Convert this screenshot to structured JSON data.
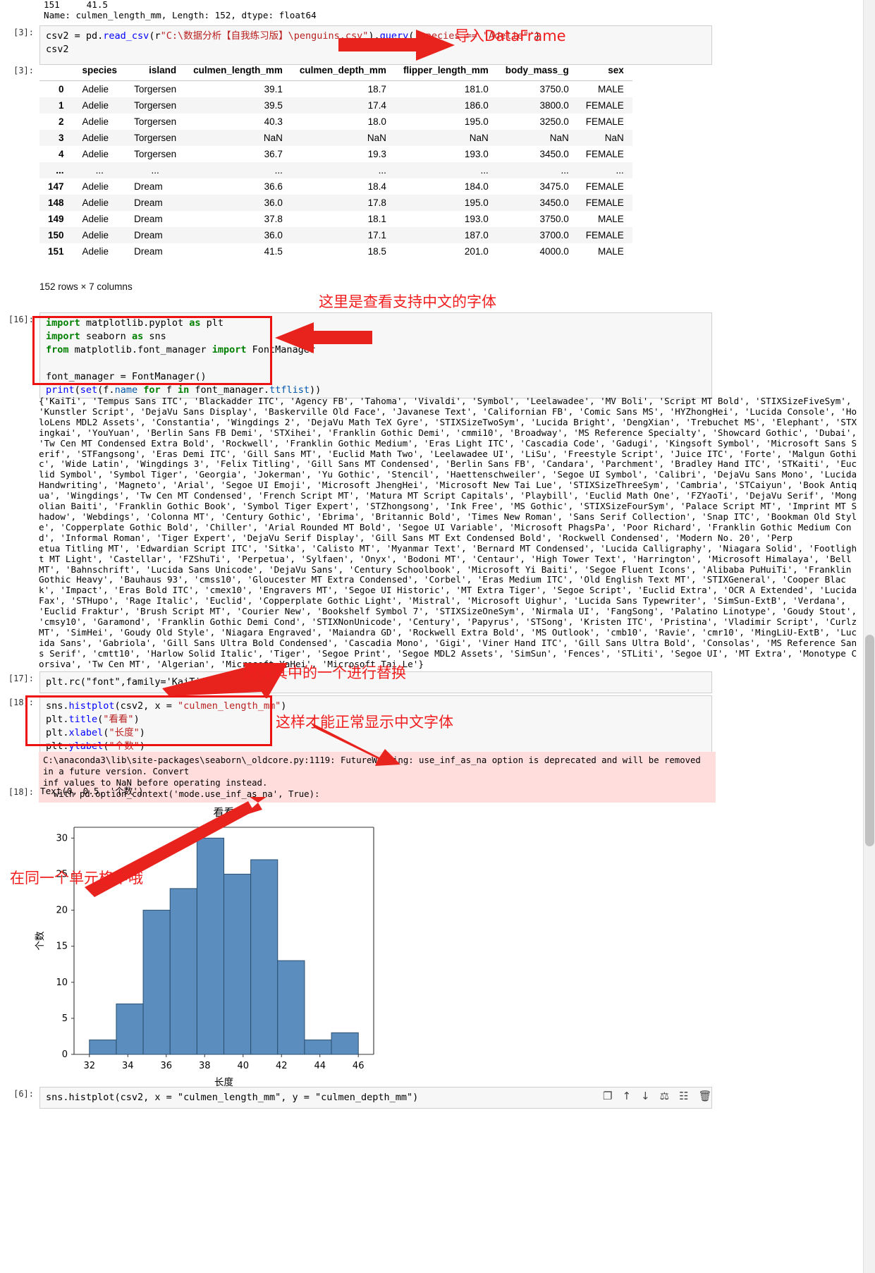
{
  "top_output": "151     41.5\nName: culmen_length_mm, Length: 152, dtype: float64",
  "cells": {
    "c3": {
      "prompt": "[3]:",
      "code_line1_a": "csv2 = pd.",
      "code_line1_fn": "read_csv",
      "code_line1_b": "(r",
      "code_line1_str": "\"C:\\数据分析【自我练习版】\\penguins.csv\"",
      "code_line1_c": ").",
      "code_line1_fn2": "query",
      "code_line1_d": "(",
      "code_line1_str2": "'species == \"Adelie\"'",
      "code_line1_e": ")",
      "code_line2": "csv2"
    },
    "c3out_prompt": "[3]:",
    "c16": {
      "prompt": "[16]:",
      "lines": [
        "import matplotlib.pyplot as plt",
        "import seaborn as sns",
        "from matplotlib.font_manager import FontManager",
        "",
        "font_manager = FontManager()",
        "print(set(f.name for f in font_manager.ttflist))"
      ]
    },
    "c17": {
      "prompt": "[17]:",
      "code": "plt.rc(\"font\",family='KaiTi')"
    },
    "c18": {
      "prompt": "[18]:",
      "lines": [
        "sns.histplot(csv2, x = \"culmen_length_mm\")",
        "plt.title(\"看看\")",
        "plt.xlabel(\"长度\")",
        "plt.ylabel(\"个数\")"
      ]
    },
    "c18out_prompt": "[18]:",
    "c18out_text": "Text(0, 0.5, '个数')",
    "c6": {
      "prompt": "[6]:",
      "code": "sns.histplot(csv2, x = \"culmen_length_mm\", y = \"culmen_depth_mm\")"
    }
  },
  "dataframe": {
    "columns": [
      "species",
      "island",
      "culmen_length_mm",
      "culmen_depth_mm",
      "flipper_length_mm",
      "body_mass_g",
      "sex"
    ],
    "rows": [
      {
        "idx": "0",
        "species": "Adelie",
        "island": "Torgersen",
        "culmen_length_mm": "39.1",
        "culmen_depth_mm": "18.7",
        "flipper_length_mm": "181.0",
        "body_mass_g": "3750.0",
        "sex": "MALE"
      },
      {
        "idx": "1",
        "species": "Adelie",
        "island": "Torgersen",
        "culmen_length_mm": "39.5",
        "culmen_depth_mm": "17.4",
        "flipper_length_mm": "186.0",
        "body_mass_g": "3800.0",
        "sex": "FEMALE"
      },
      {
        "idx": "2",
        "species": "Adelie",
        "island": "Torgersen",
        "culmen_length_mm": "40.3",
        "culmen_depth_mm": "18.0",
        "flipper_length_mm": "195.0",
        "body_mass_g": "3250.0",
        "sex": "FEMALE"
      },
      {
        "idx": "3",
        "species": "Adelie",
        "island": "Torgersen",
        "culmen_length_mm": "NaN",
        "culmen_depth_mm": "NaN",
        "flipper_length_mm": "NaN",
        "body_mass_g": "NaN",
        "sex": "NaN"
      },
      {
        "idx": "4",
        "species": "Adelie",
        "island": "Torgersen",
        "culmen_length_mm": "36.7",
        "culmen_depth_mm": "19.3",
        "flipper_length_mm": "193.0",
        "body_mass_g": "3450.0",
        "sex": "FEMALE"
      },
      {
        "idx": "...",
        "species": "...",
        "island": "...",
        "culmen_length_mm": "...",
        "culmen_depth_mm": "...",
        "flipper_length_mm": "...",
        "body_mass_g": "...",
        "sex": "..."
      },
      {
        "idx": "147",
        "species": "Adelie",
        "island": "Dream",
        "culmen_length_mm": "36.6",
        "culmen_depth_mm": "18.4",
        "flipper_length_mm": "184.0",
        "body_mass_g": "3475.0",
        "sex": "FEMALE"
      },
      {
        "idx": "148",
        "species": "Adelie",
        "island": "Dream",
        "culmen_length_mm": "36.0",
        "culmen_depth_mm": "17.8",
        "flipper_length_mm": "195.0",
        "body_mass_g": "3450.0",
        "sex": "FEMALE"
      },
      {
        "idx": "149",
        "species": "Adelie",
        "island": "Dream",
        "culmen_length_mm": "37.8",
        "culmen_depth_mm": "18.1",
        "flipper_length_mm": "193.0",
        "body_mass_g": "3750.0",
        "sex": "MALE"
      },
      {
        "idx": "150",
        "species": "Adelie",
        "island": "Dream",
        "culmen_length_mm": "36.0",
        "culmen_depth_mm": "17.1",
        "flipper_length_mm": "187.0",
        "body_mass_g": "3700.0",
        "sex": "FEMALE"
      },
      {
        "idx": "151",
        "species": "Adelie",
        "island": "Dream",
        "culmen_length_mm": "41.5",
        "culmen_depth_mm": "18.5",
        "flipper_length_mm": "201.0",
        "body_mass_g": "4000.0",
        "sex": "MALE"
      }
    ],
    "shape": "152 rows × 7 columns"
  },
  "font_list_output": "{'KaiTi', 'Tempus Sans ITC', 'Blackadder ITC', 'Agency FB', 'Tahoma', 'Vivaldi', 'Symbol', 'Leelawadee', 'MV Boli', 'Script MT Bold', 'STIXSizeFiveSym',\n'Kunstler Script', 'DejaVu Sans Display', 'Baskerville Old Face', 'Javanese Text', 'Californian FB', 'Comic Sans MS', 'HYZhongHei', 'Lucida Console', 'Ho\nloLens MDL2 Assets', 'Constantia', 'Wingdings 2', 'DejaVu Math TeX Gyre', 'STIXSizeTwoSym', 'Lucida Bright', 'DengXian', 'Trebuchet MS', 'Elephant', 'STX\ningkai', 'YouYuan', 'Berlin Sans FB Demi', 'STXihei', 'Franklin Gothic Demi', 'cmmi10', 'Broadway', 'MS Reference Specialty', 'Showcard Gothic', 'Dubai',\n'Tw Cen MT Condensed Extra Bold', 'Rockwell', 'Franklin Gothic Medium', 'Eras Light ITC', 'Cascadia Code', 'Gadugi', 'Kingsoft Symbol', 'Microsoft Sans S\nerif', 'STFangsong', 'Eras Demi ITC', 'Gill Sans MT', 'Euclid Math Two', 'Leelawadee UI', 'LiSu', 'Freestyle Script', 'Juice ITC', 'Forte', 'Malgun Gothi\nc', 'Wide Latin', 'Wingdings 3', 'Felix Titling', 'Gill Sans MT Condensed', 'Berlin Sans FB', 'Candara', 'Parchment', 'Bradley Hand ITC', 'STKaiti', 'Euc\nlid Symbol', 'Symbol Tiger', 'Georgia', 'Jokerman', 'Yu Gothic', 'Stencil', 'Haettenschweiler', 'Segoe UI Symbol', 'Calibri', 'DejaVu Sans Mono', 'Lucida\nHandwriting', 'Magneto', 'Arial', 'Segoe UI Emoji', 'Microsoft JhengHei', 'Microsoft New Tai Lue', 'STIXSizeThreeSym', 'Cambria', 'STCaiyun', 'Book Antiq\nua', 'Wingdings', 'Tw Cen MT Condensed', 'French Script MT', 'Matura MT Script Capitals', 'Playbill', 'Euclid Math One', 'FZYaoTi', 'DejaVu Serif', 'Mong\nolian Baiti', 'Franklin Gothic Book', 'Symbol Tiger Expert', 'STZhongsong', 'Ink Free', 'MS Gothic', 'STIXSizeFourSym', 'Palace Script MT', 'Imprint MT S\nhadow', 'Webdings', 'Colonna MT', 'Century Gothic', 'Ebrima', 'Britannic Bold', 'Times New Roman', 'Sans Serif Collection', 'Snap ITC', 'Bookman Old Styl\ne', 'Copperplate Gothic Bold', 'Chiller', 'Arial Rounded MT Bold', 'Segoe UI Variable', 'Microsoft PhagsPa', 'Poor Richard', 'Franklin Gothic Medium Con\nd', 'Informal Roman', 'Tiger Expert', 'DejaVu Serif Display', 'Gill Sans MT Ext Condensed Bold', 'Rockwell Condensed', 'Modern No. 20', 'Perp\netua Titling MT', 'Edwardian Script ITC', 'Sitka', 'Calisto MT', 'Myanmar Text', 'Bernard MT Condensed', 'Lucida Calligraphy', 'Niagara Solid', 'Footligh\nt MT Light', 'Castellar', 'FZShuTi', 'Perpetua', 'Sylfaen', 'Onyx', 'Bodoni MT', 'Centaur', 'High Tower Text', 'Harrington', 'Microsoft Himalaya', 'Bell\nMT', 'Bahnschrift', 'Lucida Sans Unicode', 'DejaVu Sans', 'Century Schoolbook', 'Microsoft Yi Baiti', 'Segoe Fluent Icons', 'Alibaba PuHuiTi', 'Franklin\nGothic Heavy', 'Bauhaus 93', 'cmss10', 'Gloucester MT Extra Condensed', 'Corbel', 'Eras Medium ITC', 'Old English Text MT', 'STIXGeneral', 'Cooper Blac\nk', 'Impact', 'Eras Bold ITC', 'cmex10', 'Engravers MT', 'Segoe UI Historic', 'MT Extra Tiger', 'Segoe Script', 'Euclid Extra', 'OCR A Extended', 'Lucida\nFax', 'STHupo', 'Rage Italic', 'Euclid', 'Copperplate Gothic Light', 'Mistral', 'Microsoft Uighur', 'Lucida Sans Typewriter', 'SimSun-ExtB', 'Verdana',\n'Euclid Fraktur', 'Brush Script MT', 'Courier New', 'Bookshelf Symbol 7', 'STIXSizeOneSym', 'Nirmala UI', 'FangSong', 'Palatino Linotype', 'Goudy Stout',\n'cmsy10', 'Garamond', 'Franklin Gothic Demi Cond', 'STIXNonUnicode', 'Century', 'Papyrus', 'STSong', 'Kristen ITC', 'Pristina', 'Vladimir Script', 'Curlz\nMT', 'SimHei', 'Goudy Old Style', 'Niagara Engraved', 'Maiandra GD', 'Rockwell Extra Bold', 'MS Outlook', 'cmb10', 'Ravie', 'cmr10', 'MingLiU-ExtB', 'Luc\nida Sans', 'Gabriola', 'Gill Sans Ultra Bold Condensed', 'Cascadia Mono', 'Gigi', 'Viner Hand ITC', 'Gill Sans Ultra Bold', 'Consolas', 'MS Reference San\ns Serif', 'cmtt10', 'Harlow Solid Italic', 'Tiger', 'Segoe Print', 'Segoe MDL2 Assets', 'SimSun', 'Fences', 'STLiti', 'Segoe UI', 'MT Extra', 'Monotype C\norsiva', 'Tw Cen MT', 'Algerian', 'Microsoft YaHei', 'Microsoft Tai Le'}",
  "warning_output": "C:\\anaconda3\\lib\\site-packages\\seaborn\\_oldcore.py:1119: FutureWarning: use_inf_as_na option is deprecated and will be removed in a future version. Convert\ninf values to NaN before operating instead.\n  with pd.option_context('mode.use_inf_as_na', True):",
  "annotations": [
    {
      "id": "a1",
      "text": "导入DataFrame"
    },
    {
      "id": "a2",
      "text": "这里是查看支持中文的字体"
    },
    {
      "id": "a3",
      "text": "选择其中的一个进行替换"
    },
    {
      "id": "a4",
      "text": "这样才能正常显示中文字体"
    },
    {
      "id": "a5",
      "text": "在同一个单元格中哦"
    }
  ],
  "toolbar_icons": [
    "copy-icon",
    "move-up-icon",
    "move-down-icon",
    "merge-icon",
    "split-icon",
    "delete-icon"
  ],
  "chart_data": {
    "type": "bar",
    "title": "看看",
    "xlabel": "长度",
    "ylabel": "个数",
    "bin_edges": [
      32.0,
      33.4,
      34.8,
      36.2,
      37.6,
      39.0,
      40.4,
      41.8,
      43.2,
      44.6,
      46.0
    ],
    "categories": [
      "32.0–33.4",
      "33.4–34.8",
      "34.8–36.2",
      "36.2–37.6",
      "37.6–39.0",
      "39.0–40.4",
      "40.4–41.8",
      "41.8–43.2",
      "43.2–44.6",
      "44.6–46.0"
    ],
    "values": [
      2,
      7,
      20,
      23,
      30,
      25,
      27,
      13,
      2,
      3
    ],
    "xticks": [
      32,
      34,
      36,
      38,
      40,
      42,
      44,
      46
    ],
    "yticks": [
      0,
      5,
      10,
      15,
      20,
      25,
      30
    ],
    "xlim": [
      31.2,
      46.8
    ],
    "ylim": [
      0,
      31.5
    ],
    "bar_color": "#5B8EBE",
    "bar_edge_color": "#2a4f70",
    "grid": false,
    "legend": null
  }
}
